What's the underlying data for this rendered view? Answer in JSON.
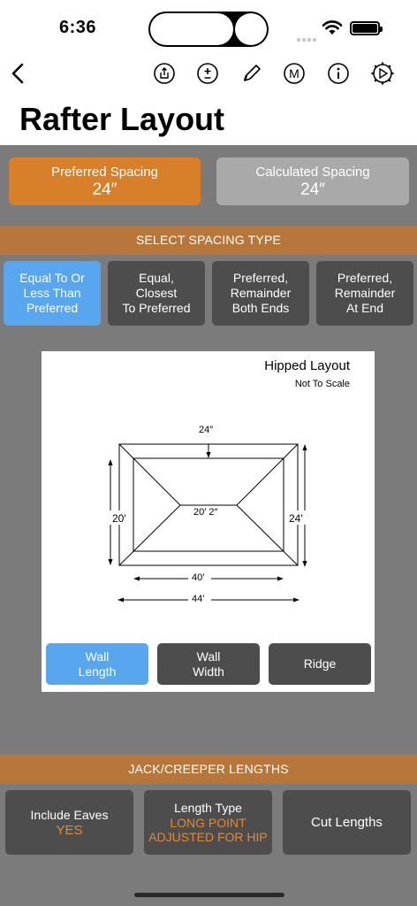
{
  "status": {
    "time": "6:36"
  },
  "nav": {
    "back_icon": "chevron-left-icon",
    "actions": [
      "share-icon",
      "plus-minus-icon",
      "pencil-icon",
      "m-circle-icon",
      "info-icon",
      "gear-play-icon"
    ]
  },
  "title": "Rafter Layout",
  "spacing": {
    "preferred_label": "Preferred Spacing",
    "preferred_value": "24″",
    "calculated_label": "Calculated Spacing",
    "calculated_value": "24″"
  },
  "select_spacing": {
    "header": "SELECT SPACING TYPE",
    "options": [
      {
        "label": "Equal To Or\nLess Than\nPreferred",
        "active": true
      },
      {
        "label": "Equal,\nClosest\nTo Preferred",
        "active": false
      },
      {
        "label": "Preferred,\nRemainder\nBoth Ends",
        "active": false
      },
      {
        "label": "Preferred,\nRemainder\nAt End",
        "active": false
      }
    ]
  },
  "diagram": {
    "title": "Hipped Layout",
    "subtitle": "Not To Scale",
    "dims": {
      "top_spacing": "24″",
      "left_height": "20′",
      "ridge": "20′ 2″",
      "right_height": "24′",
      "inner_width": "40′",
      "outer_width": "44′"
    },
    "modes": [
      {
        "label": "Wall\nLength",
        "active": true
      },
      {
        "label": "Wall\nWidth",
        "active": false
      },
      {
        "label": "Ridge",
        "active": false
      }
    ]
  },
  "jack": {
    "header": "JACK/CREEPER LENGTHS",
    "include_eaves_label": "Include Eaves",
    "include_eaves_value": "YES",
    "length_type_label": "Length Type",
    "length_type_value_1": "LONG POINT",
    "length_type_value_2": "ADJUSTED FOR HIP",
    "cut_lengths_label": "Cut Lengths"
  },
  "colors": {
    "accent_orange": "#d87f2a",
    "section_bar": "#b8773a",
    "active_blue": "#58a6ed",
    "button_dark": "#4d4d4d",
    "sheet_bg": "#7b7b7b"
  }
}
